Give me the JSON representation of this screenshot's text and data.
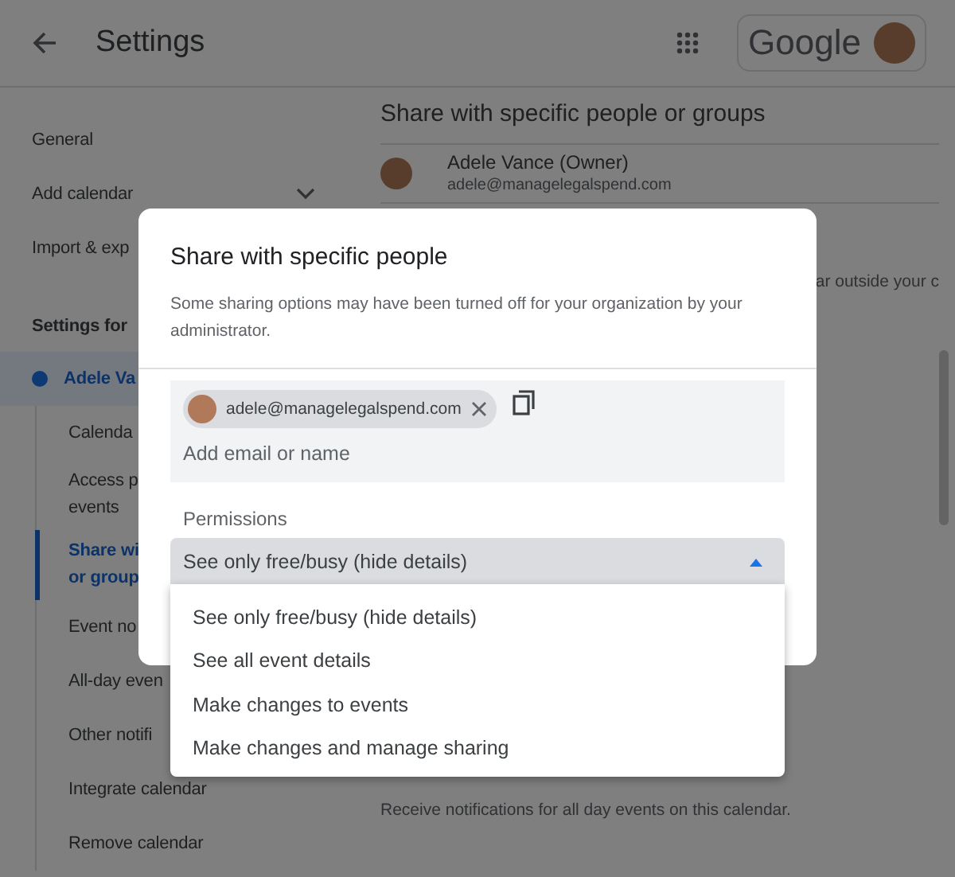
{
  "header": {
    "title": "Settings",
    "logo": "Google"
  },
  "sidebar": {
    "items": [
      {
        "label": "General",
        "kind": "item"
      },
      {
        "label": "Add calendar",
        "kind": "expander",
        "expanded": false
      },
      {
        "label": "Import & exp",
        "kind": "item"
      },
      {
        "label": "Settings for",
        "kind": "heading"
      },
      {
        "label": "Adele Va",
        "kind": "calendar",
        "selected": true
      },
      {
        "label": "Calenda",
        "kind": "sub",
        "selected": false
      },
      {
        "label": "Access p\nevents",
        "kind": "sub",
        "selected": false
      },
      {
        "label": "Share wi\nor group",
        "kind": "sub",
        "selected": true
      },
      {
        "label": "Event no",
        "kind": "sub",
        "selected": false
      },
      {
        "label": "All-day even",
        "kind": "sub",
        "selected": false
      },
      {
        "label": "Other notifi",
        "kind": "sub",
        "selected": false
      },
      {
        "label": "Integrate calendar",
        "kind": "sub",
        "selected": false
      },
      {
        "label": "Remove calendar",
        "kind": "sub",
        "selected": false
      }
    ]
  },
  "content": {
    "section_title": "Share with specific people or groups",
    "owner": {
      "name": "Adele Vance (Owner)",
      "email": "adele@managelegalspend.com"
    },
    "partial_text": "ar outside your c",
    "notice": "Receive notifications for all day events on this calendar."
  },
  "dialog": {
    "title": "Share with specific people",
    "description": "Some sharing options may have been turned off for your organization by your administrator.",
    "chips": [
      {
        "email": "adele@managelegalspend.com"
      }
    ],
    "input": {
      "placeholder": "Add email or name"
    },
    "permissions_label": "Permissions",
    "select": {
      "value": "See only free/busy (hide details)",
      "expanded": true
    },
    "options": [
      {
        "label": "See only free/busy (hide details)"
      },
      {
        "label": "See all event details"
      },
      {
        "label": "Make changes to events"
      },
      {
        "label": "Make changes and manage sharing"
      }
    ]
  }
}
